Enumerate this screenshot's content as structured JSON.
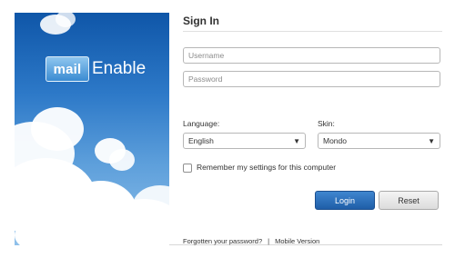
{
  "logo": {
    "mail_text": "mail",
    "brand_text": "Enable"
  },
  "form": {
    "title": "Sign In",
    "username_placeholder": "Username",
    "password_placeholder": "Password",
    "language_label": "Language:",
    "language_value": "English",
    "skin_label": "Skin:",
    "skin_value": "Mondo",
    "remember_label": "Remember my settings for this computer",
    "remember_checked": false,
    "login_label": "Login",
    "reset_label": "Reset"
  },
  "footer": {
    "forgot_label": "Forgotten your password?",
    "separator": "|",
    "mobile_label": "Mobile Version"
  },
  "icons": {
    "dropdown": "chevron-down-icon",
    "logo": "mail-envelope-icon"
  },
  "colors": {
    "login_button": "#2a6db8",
    "sky": "#2d79c8"
  }
}
